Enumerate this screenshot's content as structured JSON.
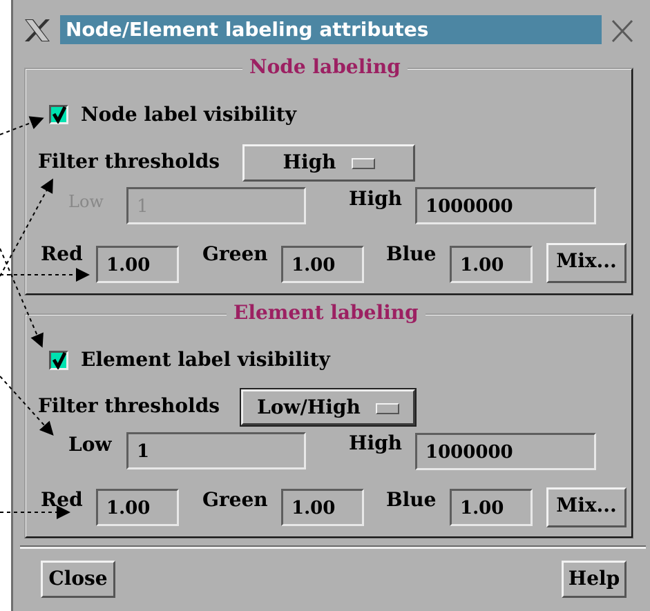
{
  "window": {
    "title": "Node/Element labeling attributes"
  },
  "node": {
    "group_title": "Node labeling",
    "visibility_label": "Node label visibility",
    "visibility_checked": true,
    "filter_label": "Filter thresholds",
    "filter_value": "High",
    "low_label": "Low",
    "low_value": "1",
    "high_label": "High",
    "high_value": "1000000",
    "red_label": "Red",
    "red_value": "1.00",
    "green_label": "Green",
    "green_value": "1.00",
    "blue_label": "Blue",
    "blue_value": "1.00",
    "mix_label": "Mix..."
  },
  "element": {
    "group_title": "Element labeling",
    "visibility_label": "Element label visibility",
    "visibility_checked": true,
    "filter_label": "Filter thresholds",
    "filter_value": "Low/High",
    "low_label": "Low",
    "low_value": "1",
    "high_label": "High",
    "high_value": "1000000",
    "red_label": "Red",
    "red_value": "1.00",
    "green_label": "Green",
    "green_value": "1.00",
    "blue_label": "Blue",
    "blue_value": "1.00",
    "mix_label": "Mix..."
  },
  "footer": {
    "close_label": "Close",
    "help_label": "Help"
  },
  "colors": {
    "title_bar": "#4c86a3",
    "group_title": "#9c2062",
    "checkbox": "#00e2b0",
    "panel": "#b1b1b1"
  }
}
